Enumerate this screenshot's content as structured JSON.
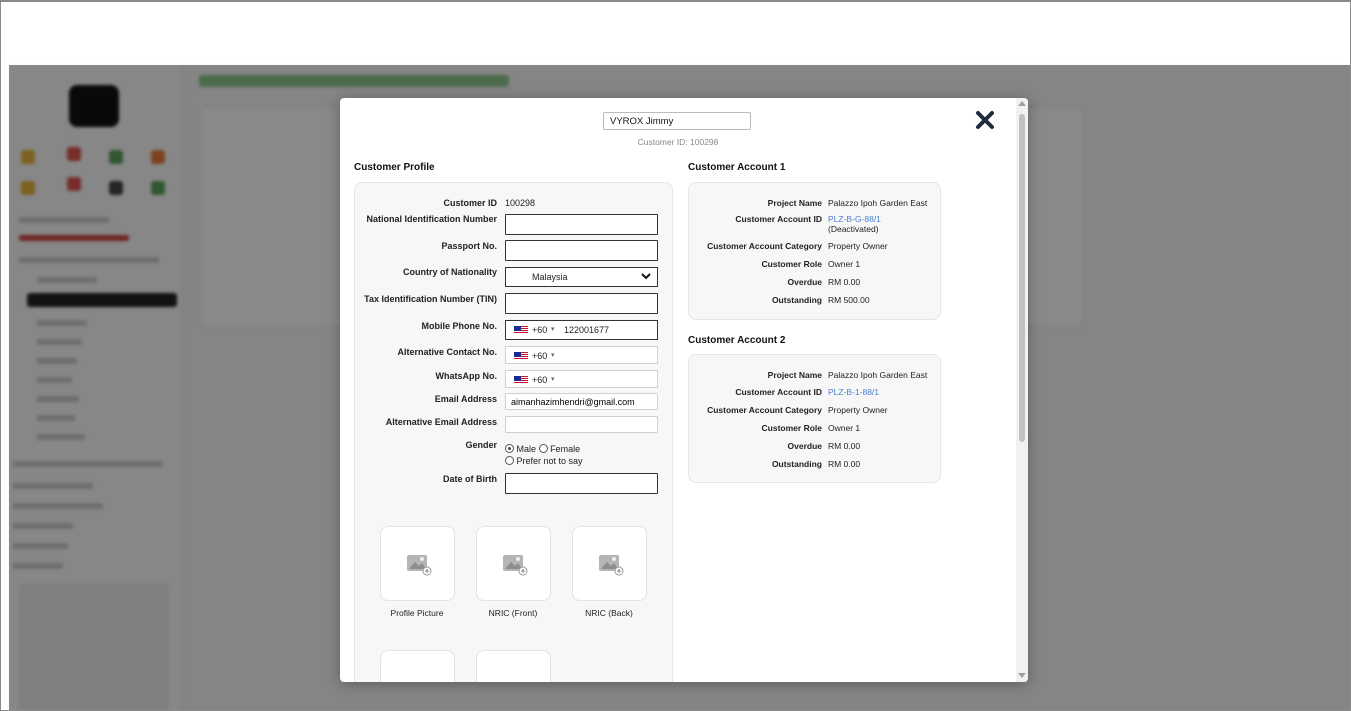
{
  "header": {
    "name_value": "VYROX Jimmy",
    "customer_id_line": "Customer ID: 100298"
  },
  "profile": {
    "title": "Customer Profile",
    "labels": {
      "customer_id": "Customer ID",
      "nin": "National Identification Number",
      "passport": "Passport No.",
      "nationality": "Country of Nationality",
      "tin": "Tax Identification Number (TIN)",
      "mobile": "Mobile Phone No.",
      "alt_contact": "Alternative Contact No.",
      "whatsapp": "WhatsApp No.",
      "email": "Email Address",
      "alt_email": "Alternative Email Address",
      "gender": "Gender",
      "dob": "Date of Birth"
    },
    "values": {
      "customer_id": "100298",
      "nationality": "Malaysia",
      "dial_code": "+60",
      "mobile_number": "122001677",
      "email": "aimanhazimhendri@gmail.com"
    },
    "gender_options": {
      "male": "Male",
      "female": "Female",
      "other": "Prefer not to say"
    },
    "uploads": [
      "Profile Picture",
      "NRIC (Front)",
      "NRIC (Back)"
    ]
  },
  "accounts": [
    {
      "title": "Customer Account 1",
      "labels": {
        "project": "Project Name",
        "account_id": "Customer Account ID",
        "category": "Customer Account Category",
        "role": "Customer Role",
        "overdue": "Overdue",
        "outstanding": "Outstanding"
      },
      "project": "Palazzo Ipoh Garden East",
      "account_id": "PLZ-B-G-88/1",
      "status": "(Deactivated)",
      "category": "Property Owner",
      "role": "Owner 1",
      "overdue": "RM 0.00",
      "outstanding": "RM 500.00"
    },
    {
      "title": "Customer Account 2",
      "labels": {
        "project": "Project Name",
        "account_id": "Customer Account ID",
        "category": "Customer Account Category",
        "role": "Customer Role",
        "overdue": "Overdue",
        "outstanding": "Outstanding"
      },
      "project": "Palazzo Ipoh Garden East",
      "account_id": "PLZ-B-1-88/1",
      "category": "Property Owner",
      "role": "Owner 1",
      "overdue": "RM 0.00",
      "outstanding": "RM 0.00"
    }
  ],
  "colors": {
    "link": "#4a7fd4",
    "close_icon": "#1f2b3a",
    "box_bg": "#f7f7f7"
  },
  "icons": {
    "close": "close-icon",
    "image_placeholder": "image-placeholder-icon",
    "chevron": "chevron-down-icon"
  }
}
